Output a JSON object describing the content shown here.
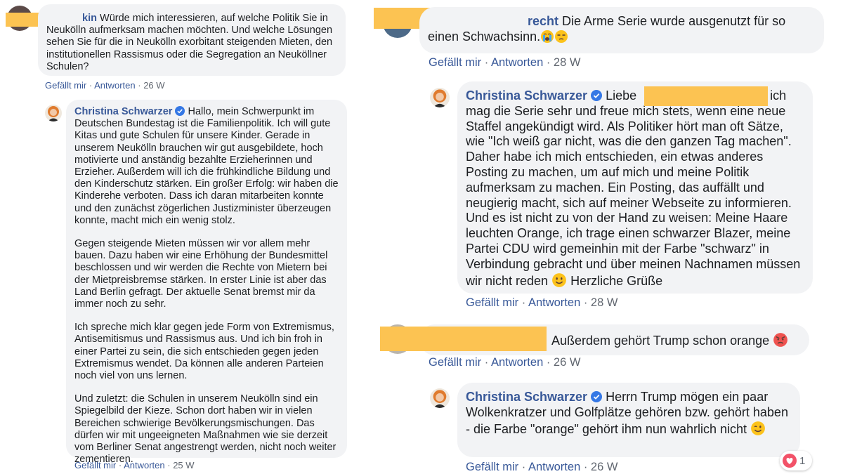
{
  "comment1": {
    "author_fragment": "kin",
    "text": "Würde mich interessieren, auf welche Politik Sie in Neukölln aufmerksam machen möchten. Und welche Lösungen sehen Sie für die in Neukölln exorbitant steigenden Mieten, den institutionellen Rassismus oder die Segregation an Neuköllner Schulen?",
    "like": "Gefällt mir",
    "reply": "Antworten",
    "time": "26 W"
  },
  "reply1": {
    "author": "Christina Schwarzer",
    "paragraphs": [
      "Hallo, mein Schwerpunkt im Deutschen Bundestag ist die Familienpolitik. Ich will gute Kitas und gute Schulen für unsere Kinder. Gerade in unserem Neukölln brauchen wir gut ausgebildete, hoch motivierte und anständig bezahlte Erzieherinnen und Erzieher. Außerdem will ich die frühkindliche Bildung und den Kinderschutz stärken. Ein großer Erfolg: wir haben die Kinderehe verboten. Dass ich daran mitarbeiten konnte und den zunächst zögerlichen Justizminister überzeugen konnte, macht mich ein wenig stolz.",
      "Gegen steigende Mieten müssen wir vor allem mehr bauen. Dazu haben wir eine Erhöhung der Bundesmittel beschlossen und wir werden die Rechte von Mietern bei der Mietpreisbremse stärken. In erster Linie ist aber das Land Berlin gefragt. Der aktuelle Senat bremst mir da immer noch zu sehr.",
      "Ich spreche mich klar gegen jede Form von Extremismus, Antisemitismus und Rassismus aus. Und ich bin froh in einer Partei zu sein, die sich entschieden gegen jeden Extremismus wendet. Da können alle anderen Parteien noch viel von uns lernen.",
      "Und zuletzt: die Schulen in unserem Neukölln sind ein Spiegelbild der Kieze. Schon dort haben wir in vielen Bereichen schwierige Bevölkerungsmischungen. Das dürfen wir mit ungeeigneten Maßnahmen wie sie derzeit vom Berliner Senat angestrengt werden, nicht noch weiter zementieren."
    ],
    "like": "Gefällt mir",
    "reply": "Antworten",
    "time": "25 W"
  },
  "comment2": {
    "author_fragment": "recht",
    "text": "Die Arme Serie wurde ausgenutzt für so einen Schwachsinn.",
    "emojis": [
      "crying-face",
      "unamused-face"
    ],
    "like": "Gefällt mir",
    "reply": "Antworten",
    "time": "28 W"
  },
  "reply2": {
    "author": "Christina Schwarzer",
    "salutation": "Liebe",
    "after_redaction": ", ich",
    "text": "mag die Serie sehr und freue mich stets, wenn eine neue Staffel angekündigt wird. Als Politiker hört man oft Sätze, wie \"Ich weiß gar nicht, was die den ganzen Tag machen\". Daher habe ich mich entschieden, ein etwas anderes Posting zu machen, um auf mich und meine Politik aufmerksam zu machen. Ein Posting, das auffällt und neugierig macht, sich auf meiner Webseite zu informieren. Und es ist nicht zu von der Hand zu weisen: Meine Haare leuchten Orange, ich trage einen schwarzer Blazer, meine Partei CDU wird gemeinhin mit der Farbe \"schwarz\" in Verbindung gebracht und über meinen Nachnamen müssen wir nicht reden",
    "text_end": "Herzliche Grüße",
    "like": "Gefällt mir",
    "reply": "Antworten",
    "time": "28 W"
  },
  "comment3": {
    "text": "Außerdem gehört Trump schon orange",
    "like": "Gefällt mir",
    "reply": "Antworten",
    "time": "26 W"
  },
  "reply3": {
    "author": "Christina Schwarzer",
    "text": "Herrn Trump mögen ein paar Wolkenkratzer und Golfplätze gehören bzw. gehört haben - die Farbe \"orange\" gehört ihm nun wahrlich nicht",
    "like": "Gefällt mir",
    "reply": "Antworten",
    "time": "26 W"
  },
  "reaction_badge": {
    "icon": "love-reaction-icon",
    "count": "1"
  },
  "colors": {
    "link": "#385898",
    "bubble": "#f2f3f5",
    "redaction": "#fcc352",
    "meta": "#616770",
    "verified": "#3578e5"
  }
}
